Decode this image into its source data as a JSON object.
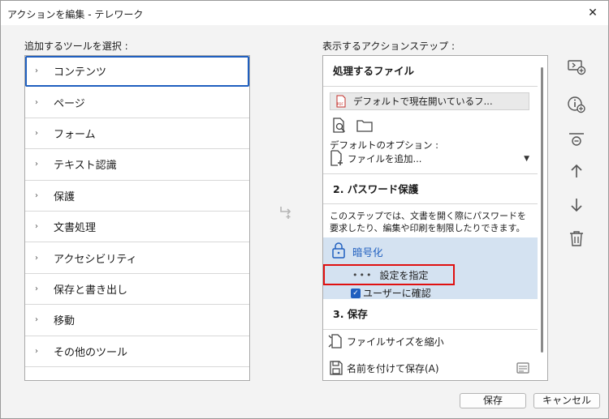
{
  "window": {
    "title": "アクションを編集 - テレワーク",
    "close": "✕"
  },
  "left": {
    "label": "追加するツールを選択 :",
    "items": [
      {
        "label": "コンテンツ"
      },
      {
        "label": "ページ"
      },
      {
        "label": "フォーム"
      },
      {
        "label": "テキスト認識"
      },
      {
        "label": "保護"
      },
      {
        "label": "文書処理"
      },
      {
        "label": "アクセシビリティ"
      },
      {
        "label": "保存と書き出し"
      },
      {
        "label": "移動"
      },
      {
        "label": "その他のツール"
      }
    ]
  },
  "right": {
    "label": "表示するアクションステップ :",
    "section1": {
      "title": "処理するファイル",
      "file": "デフォルトで現在開いているフ...",
      "options_label": "デフォルトのオプション :",
      "options_value": "ファイルを追加..."
    },
    "section2": {
      "title": "2. パスワード保護",
      "description": "このステップでは、文書を開く際にパスワードを要求したり、編集や印刷を制限したりできます。",
      "encrypt": "暗号化",
      "specify_settings": "設定を指定",
      "confirm_user": "ユーザーに確認"
    },
    "section3": {
      "title": "3. 保存",
      "reduce_size": "ファイルサイズを縮小",
      "save_as": "名前を付けて保存(A)"
    }
  },
  "footer": {
    "save": "保存",
    "cancel": "キャンセル"
  },
  "colors": {
    "accent": "#1f5fbf",
    "highlight_border": "#e01010",
    "selected_block": "#d4e2f1"
  }
}
